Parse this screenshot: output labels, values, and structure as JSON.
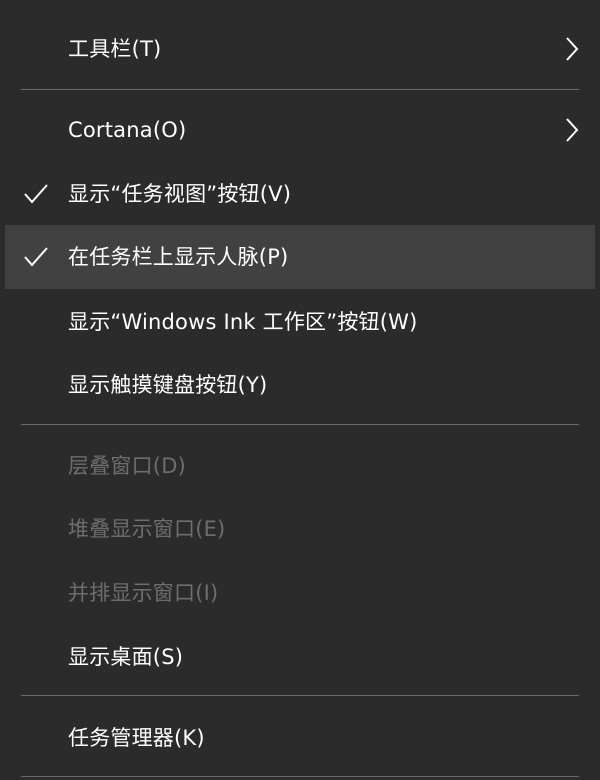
{
  "menu": {
    "items": [
      {
        "label": "工具栏(T)"
      },
      {
        "label": "Cortana(O)"
      },
      {
        "label": "显示“任务视图”按钮(V)"
      },
      {
        "label": "在任务栏上显示人脉(P)"
      },
      {
        "label": "显示“Windows Ink 工作区”按钮(W)"
      },
      {
        "label": "显示触摸键盘按钮(Y)"
      },
      {
        "label": "层叠窗口(D)"
      },
      {
        "label": "堆叠显示窗口(E)"
      },
      {
        "label": "并排显示窗口(I)"
      },
      {
        "label": "显示桌面(S)"
      },
      {
        "label": "任务管理器(K)"
      }
    ]
  },
  "colors": {
    "background": "#2b2b2b",
    "highlight": "#414141",
    "text": "#ffffff",
    "disabled_text": "#6d6d6d",
    "separator": "#6a6a6a"
  }
}
